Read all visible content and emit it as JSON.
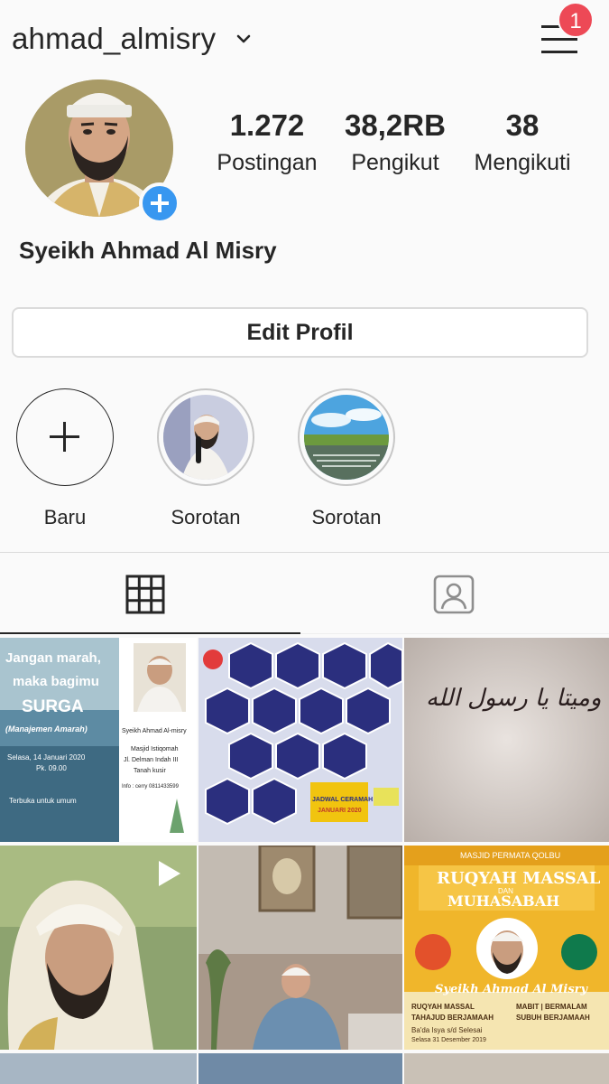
{
  "header": {
    "username": "ahmad_almisry",
    "notification_count": "1"
  },
  "profile": {
    "full_name": "Syeikh Ahmad Al Misry",
    "stats": {
      "posts_count": "1.272",
      "posts_label": "Postingan",
      "followers_count": "38,2RB",
      "followers_label": "Pengikut",
      "following_count": "38",
      "following_label": "Mengikuti"
    },
    "edit_button_label": "Edit Profil"
  },
  "highlights": [
    {
      "label": "Baru"
    },
    {
      "label": "Sorotan"
    },
    {
      "label": "Sorotan"
    }
  ],
  "tabs": [
    {
      "icon": "grid-icon",
      "active": true
    },
    {
      "icon": "tagged-icon",
      "active": false
    }
  ],
  "posts": [
    {
      "line1": "Jangan marah,",
      "line2": "maka bagimu",
      "line3": "SURGA",
      "line4": "(Manajemen Amarah)",
      "line5": "Selasa, 14 Januari 2020",
      "line6": "Pk. 09.00",
      "line7": "Terbuka untuk umum",
      "speaker": "Syeikh Ahmad Al-misry",
      "venue1": "Masjid Istiqomah",
      "venue2": "Jl. Delman Indah III",
      "venue3": "Tanah kusir",
      "info": "Info : cerry 0811433599"
    },
    {
      "title": "JADWAL CERAMAH",
      "month": "JANUARI 2020"
    },
    {
      "arabic": "طبت حيا وميتا يا رسول الله"
    },
    {},
    {},
    {
      "org": "MASJID PERMATA QOLBU",
      "title1": "RUQYAH MASSAL",
      "title2": "DAN",
      "title3": "MUHASABAH",
      "speaker": "Syeikh Ahmad Al Misry",
      "sub1": "RUQYAH MASSAL",
      "sub2": "TAHAJUD BERJAMAAH",
      "sub3": "MABIT | BERMALAM",
      "sub4": "SUBUH BERJAMAAH",
      "time": "Ba'da Isya s/d Selesai",
      "date": "Selasa 31 Desember 2019"
    }
  ],
  "colors": {
    "badge": "#ed4956",
    "accent": "#3897f0",
    "border": "#dbdbdb",
    "text": "#262626"
  }
}
